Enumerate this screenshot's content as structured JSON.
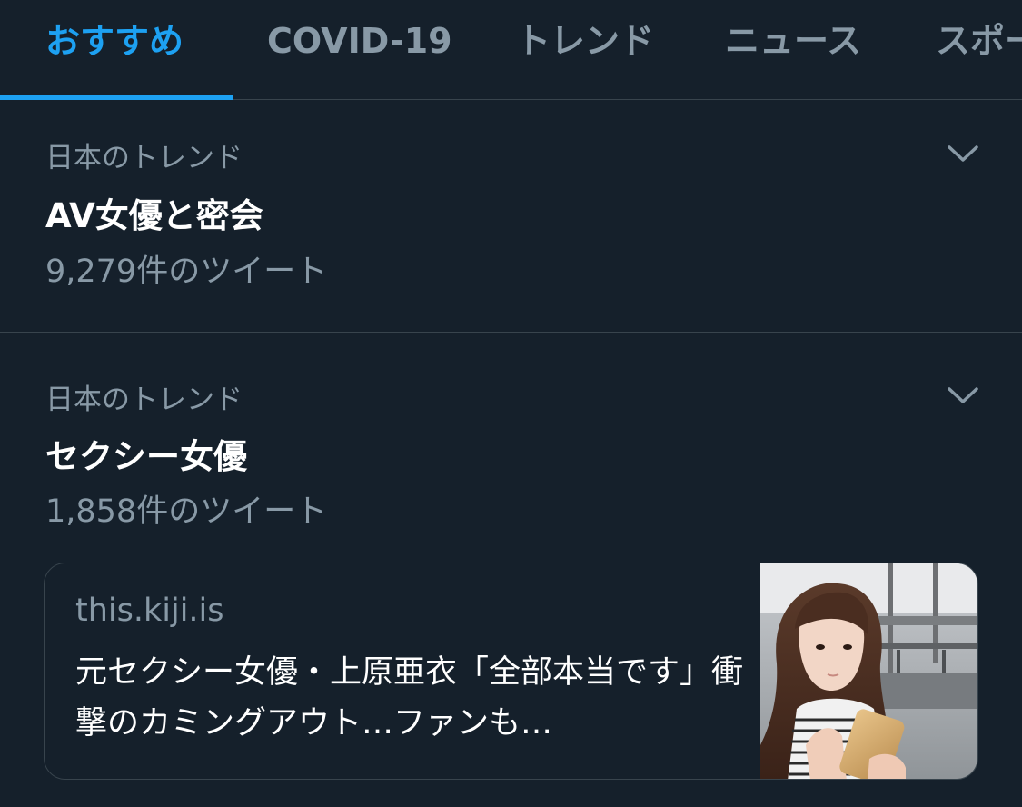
{
  "tabs": [
    {
      "label": "おすすめ",
      "active": true
    },
    {
      "label": "COVID-19",
      "active": false
    },
    {
      "label": "トレンド",
      "active": false
    },
    {
      "label": "ニュース",
      "active": false
    },
    {
      "label": "スポー",
      "active": false
    }
  ],
  "trends": [
    {
      "context": "日本のトレンド",
      "title": "AV女優と密会",
      "count": "9,279件のツイート"
    },
    {
      "context": "日本のトレンド",
      "title": "セクシー女優",
      "count": "1,858件のツイート",
      "card": {
        "domain": "this.kiji.is",
        "headline": "元セクシー女優・上原亜衣「全部本当です」衝撃のカミングアウト…ファンも…"
      }
    }
  ],
  "colors": {
    "background": "#15202b",
    "accent": "#1da1f2",
    "secondary_text": "#8899a6",
    "divider": "#38444d"
  },
  "icons": {
    "trend_menu": "chevron-down-icon",
    "card_thumbnail": "photo-thumbnail"
  }
}
